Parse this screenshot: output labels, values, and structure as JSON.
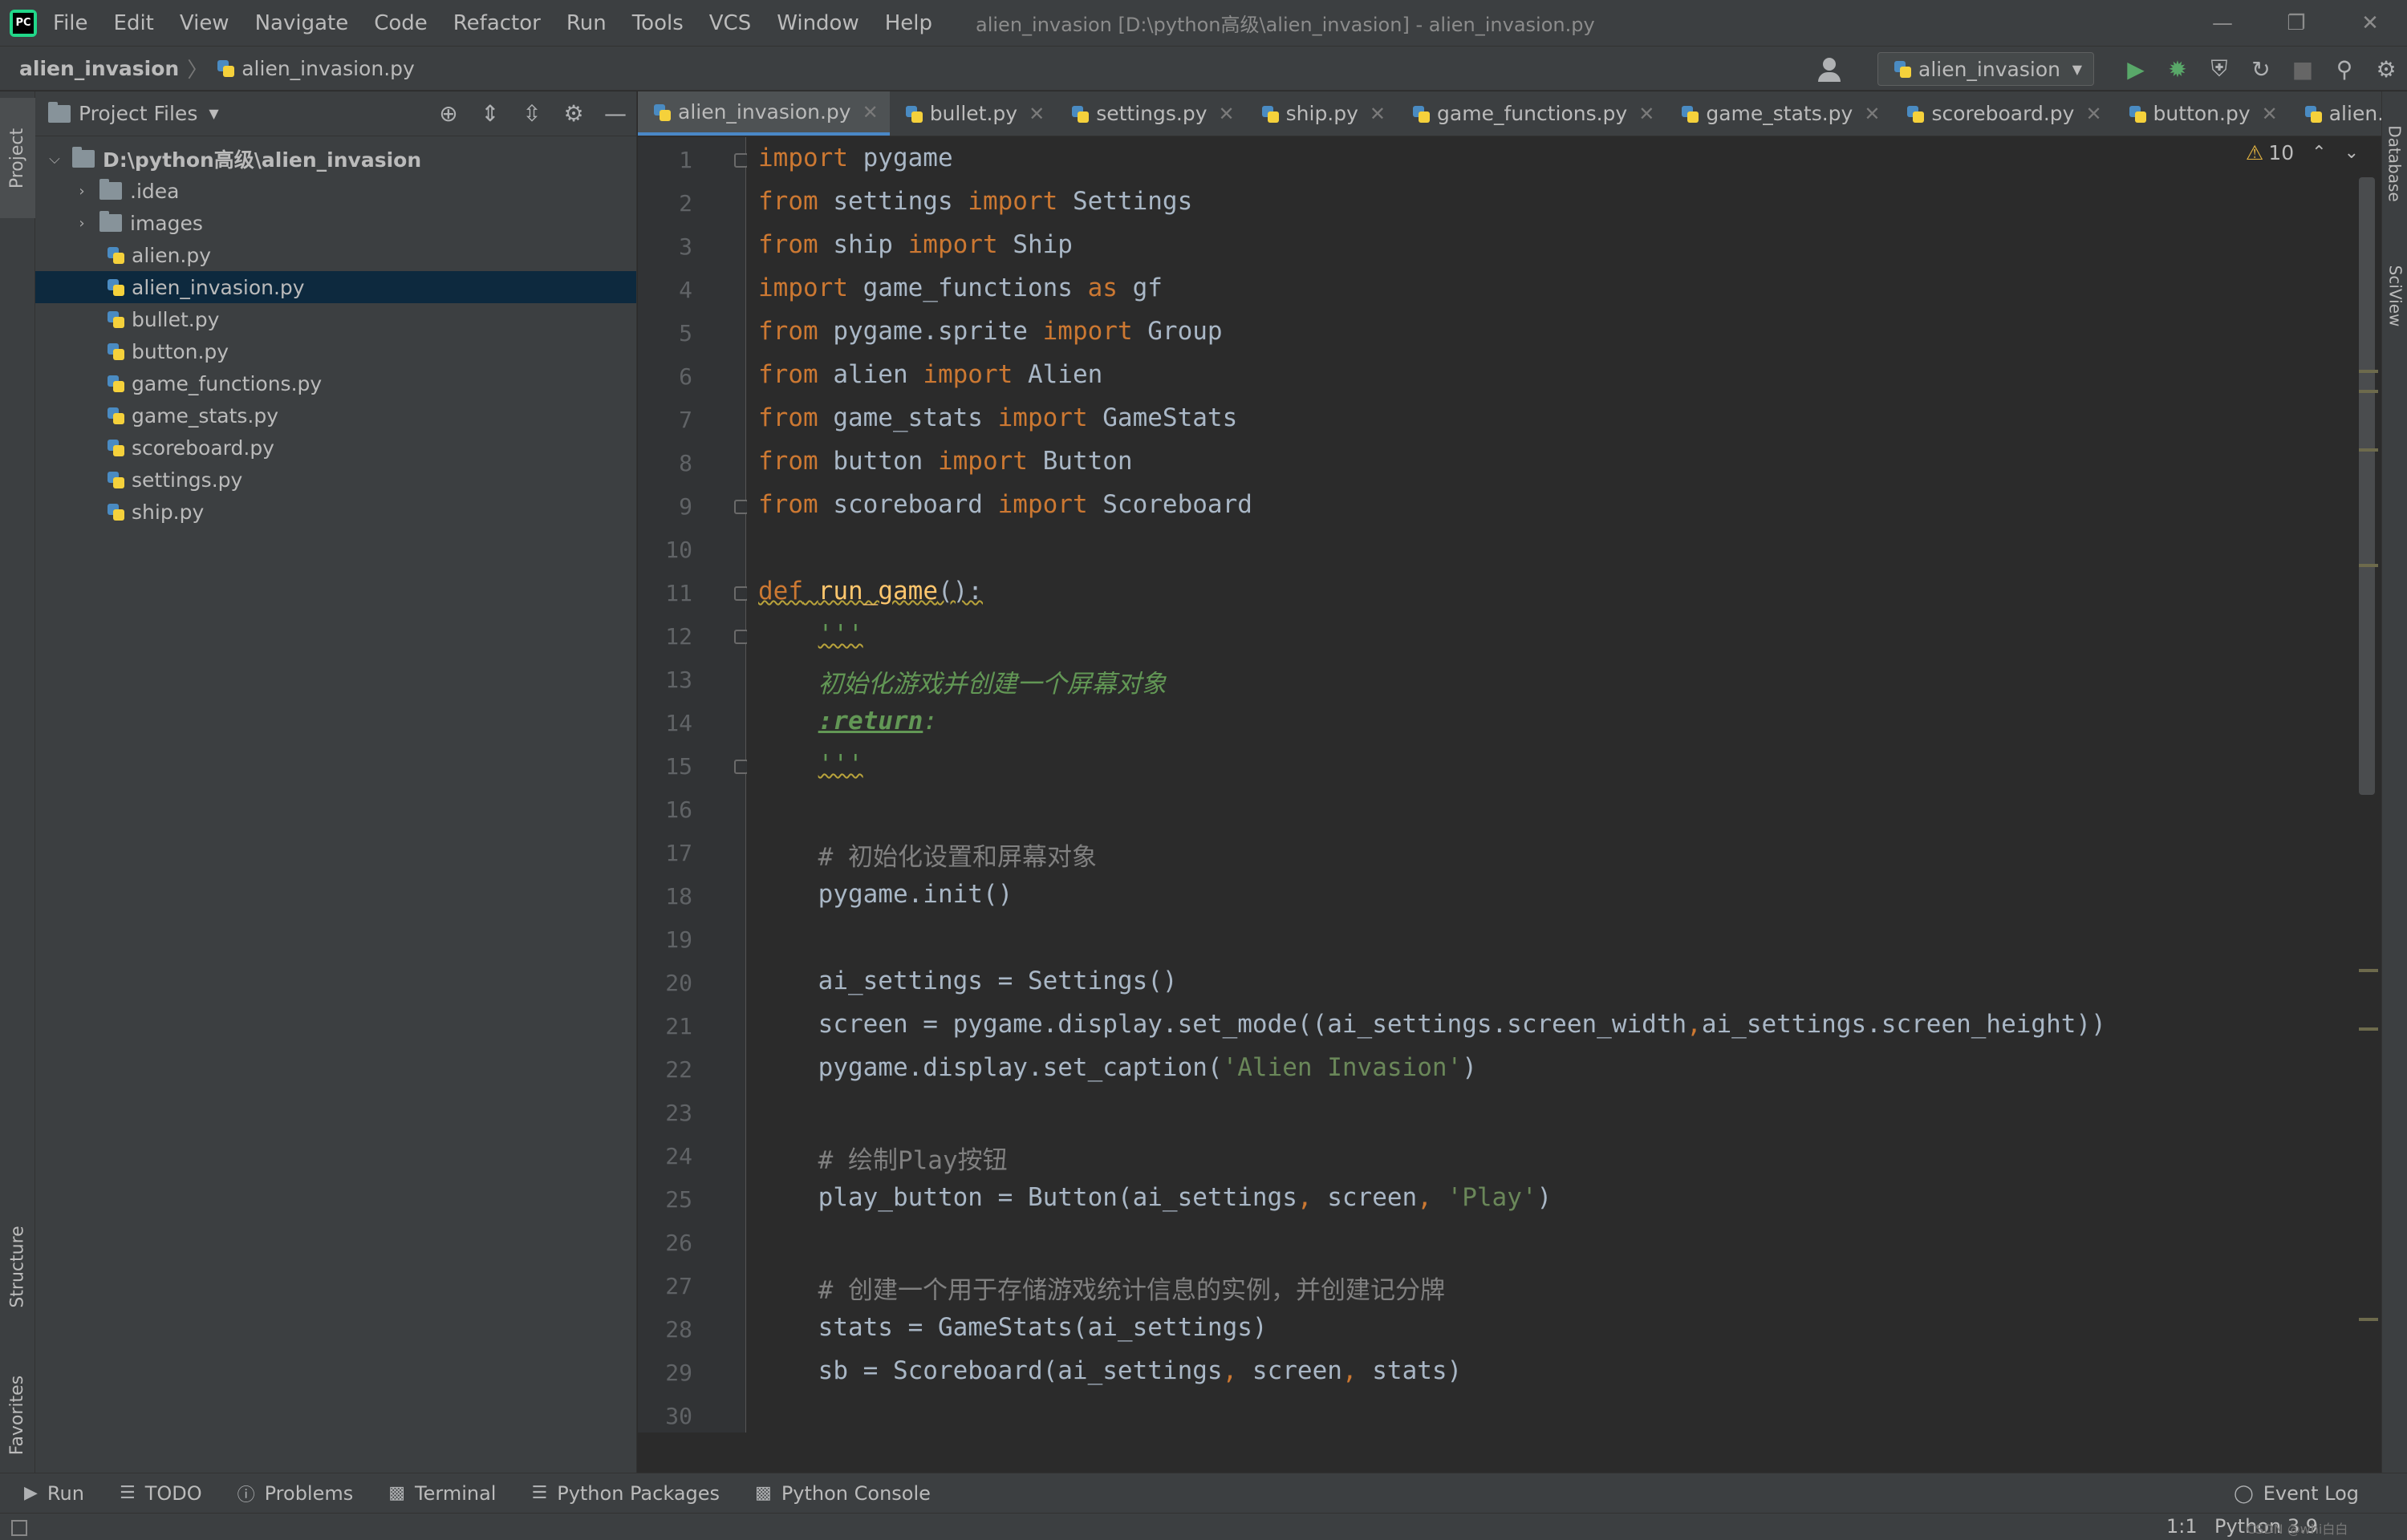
{
  "menubar": {
    "items": [
      "File",
      "Edit",
      "View",
      "Navigate",
      "Code",
      "Refactor",
      "Run",
      "Tools",
      "VCS",
      "Window",
      "Help"
    ],
    "window_title": "alien_invasion [D:\\python高级\\alien_invasion] - alien_invasion.py"
  },
  "navbar": {
    "project": "alien_invasion",
    "file": "alien_invasion.py",
    "run_config": "alien_invasion"
  },
  "left_stripe": {
    "project": "Project",
    "structure": "Structure",
    "favorites": "Favorites"
  },
  "right_stripe": {
    "database": "Database",
    "sciview": "SciView"
  },
  "project_panel": {
    "title": "Project Files",
    "tree": [
      {
        "label": "D:\\python高级\\alien_invasion",
        "kind": "root-folder"
      },
      {
        "label": ".idea",
        "kind": "folder"
      },
      {
        "label": "images",
        "kind": "folder"
      },
      {
        "label": "alien.py",
        "kind": "py"
      },
      {
        "label": "alien_invasion.py",
        "kind": "py",
        "selected": true
      },
      {
        "label": "bullet.py",
        "kind": "py"
      },
      {
        "label": "button.py",
        "kind": "py"
      },
      {
        "label": "game_functions.py",
        "kind": "py"
      },
      {
        "label": "game_stats.py",
        "kind": "py"
      },
      {
        "label": "scoreboard.py",
        "kind": "py"
      },
      {
        "label": "settings.py",
        "kind": "py"
      },
      {
        "label": "ship.py",
        "kind": "py"
      }
    ]
  },
  "tabs": [
    "alien_invasion.py",
    "bullet.py",
    "settings.py",
    "ship.py",
    "game_functions.py",
    "game_stats.py",
    "scoreboard.py",
    "button.py",
    "alien.py"
  ],
  "inspections": {
    "count": "10"
  },
  "line_numbers": [
    "1",
    "2",
    "3",
    "4",
    "5",
    "6",
    "7",
    "8",
    "9",
    "10",
    "11",
    "12",
    "13",
    "14",
    "15",
    "16",
    "17",
    "18",
    "19",
    "20",
    "21",
    "22",
    "23",
    "24",
    "25",
    "26",
    "27",
    "28",
    "29",
    "30"
  ],
  "code": {
    "l1": [
      "import",
      " pygame"
    ],
    "l2": [
      "from",
      " settings ",
      "import",
      " Settings"
    ],
    "l3": [
      "from",
      " ship ",
      "import",
      " Ship"
    ],
    "l4": [
      "import",
      " game_functions ",
      "as",
      " gf"
    ],
    "l5": [
      "from",
      " pygame.sprite ",
      "import",
      " Group"
    ],
    "l6": [
      "from",
      " alien ",
      "import",
      " Alien"
    ],
    "l7": [
      "from",
      " game_stats ",
      "import",
      " GameStats"
    ],
    "l8": [
      "from",
      " button ",
      "import",
      " Button"
    ],
    "l9": [
      "from",
      " scoreboard ",
      "import",
      " Scoreboard"
    ],
    "l11": [
      "def",
      " ",
      "run_game",
      "():"
    ],
    "l12": [
      "    ",
      "'''"
    ],
    "l13": [
      "    ",
      "初始化游戏并创建一个屏幕对象"
    ],
    "l14": [
      "    ",
      ":return",
      ":"
    ],
    "l15": [
      "    ",
      "'''"
    ],
    "l17": [
      "    ",
      "# 初始化设置和屏幕对象"
    ],
    "l18": [
      "    pygame.init()"
    ],
    "l20": [
      "    ai_settings = Settings()"
    ],
    "l21": [
      "    screen = pygame.display.set_mode((ai_settings.screen_width",
      ",",
      "ai_settings.screen_height))"
    ],
    "l22": [
      "    pygame.display.set_caption(",
      "'Alien Invasion'",
      ")"
    ],
    "l24": [
      "    ",
      "# 绘制Play按钮"
    ],
    "l25": [
      "    play_button = Button(ai_settings",
      ",",
      " screen",
      ",",
      " ",
      "'Play'",
      ")"
    ],
    "l27": [
      "    ",
      "# 创建一个用于存储游戏统计信息的实例，并创建记分牌"
    ],
    "l28": [
      "    stats = GameStats(ai_settings)"
    ],
    "l29": [
      "    sb = Scoreboard(ai_settings",
      ",",
      " screen",
      ",",
      " stats)"
    ]
  },
  "bottom_tools": [
    "Run",
    "TODO",
    "Problems",
    "Terminal",
    "Python Packages",
    "Python Console"
  ],
  "event_log": "Event Log",
  "status": {
    "position": "1:1",
    "interpreter": "Python 3.9",
    "watermark": "CSDN @whi白白"
  }
}
